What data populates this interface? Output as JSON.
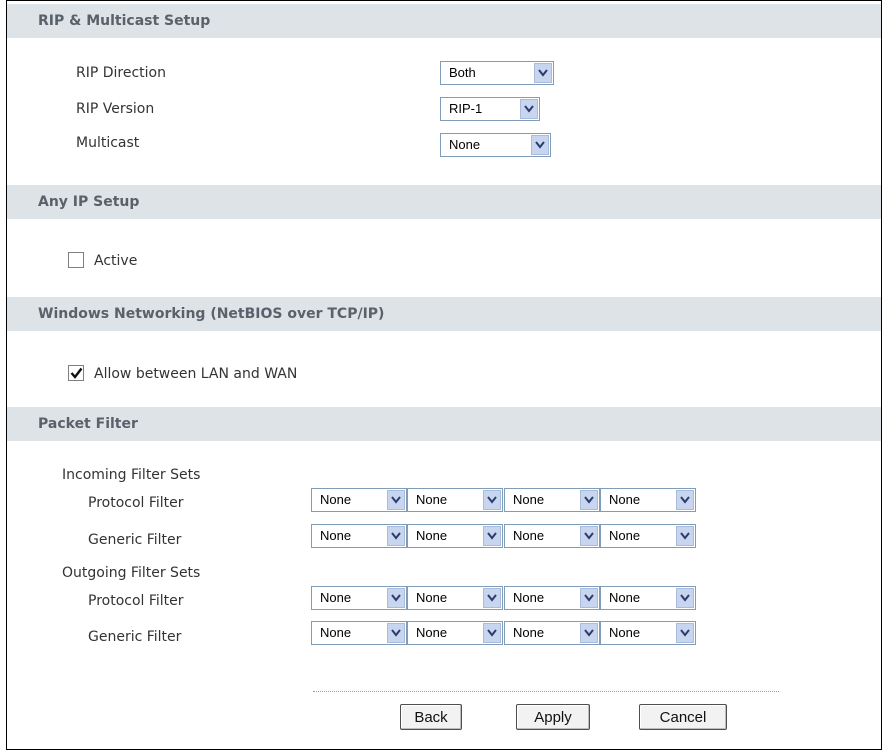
{
  "sections": {
    "rip_multicast": "RIP & Multicast Setup",
    "any_ip": "Any IP Setup",
    "windows_networking": "Windows Networking (NetBIOS over TCP/IP)",
    "packet_filter": "Packet Filter"
  },
  "rip": {
    "direction_label": "RIP Direction",
    "direction_value": "Both",
    "version_label": "RIP Version",
    "version_value": "RIP-1",
    "multicast_label": "Multicast",
    "multicast_value": "None"
  },
  "any_ip": {
    "active_label": "Active",
    "active_checked": false
  },
  "netbios": {
    "allow_label": "Allow between LAN and WAN",
    "allow_checked": true
  },
  "packet_filter": {
    "incoming_label": "Incoming Filter Sets",
    "outgoing_label": "Outgoing Filter Sets",
    "protocol_label": "Protocol Filter",
    "generic_label": "Generic Filter",
    "incoming_protocol": [
      "None",
      "None",
      "None",
      "None"
    ],
    "incoming_generic": [
      "None",
      "None",
      "None",
      "None"
    ],
    "outgoing_protocol": [
      "None",
      "None",
      "None",
      "None"
    ],
    "outgoing_generic": [
      "None",
      "None",
      "None",
      "None"
    ]
  },
  "buttons": {
    "back": "Back",
    "apply": "Apply",
    "cancel": "Cancel"
  },
  "icons": {
    "dropdown": "chevron-down-icon",
    "checkmark": "checkmark-icon"
  }
}
